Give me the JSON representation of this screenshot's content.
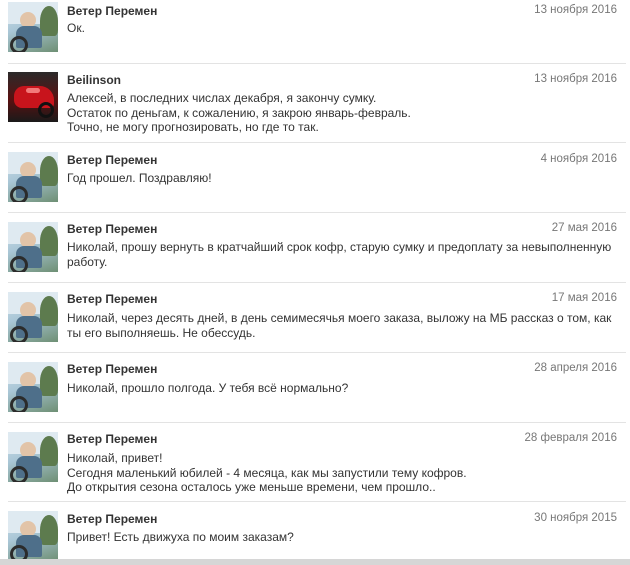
{
  "messages": [
    {
      "author": "Ветер Перемен",
      "date": "13 ноября 2016",
      "lines": [
        "Ок."
      ],
      "avatar": "wind-avatar"
    },
    {
      "author": "Beilinson",
      "date": "13 ноября 2016",
      "lines": [
        "Алексей, в последних числах декабря, я закончу сумку.",
        "Остаток по деньгам, к сожалению, я закрою январь-февраль.",
        "Точно, не могу прогнозировать, но где то так."
      ],
      "avatar": "motorcycle-avatar"
    },
    {
      "author": "Ветер Перемен",
      "date": "4 ноября 2016",
      "lines": [
        "Год прошел. Поздравляю!"
      ],
      "avatar": "wind-avatar"
    },
    {
      "author": "Ветер Перемен",
      "date": "27 мая 2016",
      "lines": [
        "Николай, прошу вернуть в кратчайший срок кофр, старую сумку и предоплату за невыполненную",
        "работу."
      ],
      "avatar": "wind-avatar"
    },
    {
      "author": "Ветер Перемен",
      "date": "17 мая 2016",
      "lines": [
        "Николай, через десять дней, в день семимесячья моего заказа, выложу на МБ рассказ о том, как",
        "ты его выполняешь. Не обессудь."
      ],
      "avatar": "wind-avatar"
    },
    {
      "author": "Ветер Перемен",
      "date": "28 апреля 2016",
      "lines": [
        "Николай, прошло полгода. У тебя всё нормально?"
      ],
      "avatar": "wind-avatar"
    },
    {
      "author": "Ветер Перемен",
      "date": "28 февраля 2016",
      "lines": [
        "Николай, привет!",
        "Сегодня маленький юбилей - 4 месяца, как мы запустили тему кофров.",
        "До открытия сезона осталось уже меньше времени, чем прошло.."
      ],
      "avatar": "wind-avatar"
    },
    {
      "author": "Ветер Перемен",
      "date": "30 ноября 2015",
      "lines": [
        "Привет! Есть движуха по моим заказам?"
      ],
      "avatar": "wind-avatar"
    }
  ]
}
